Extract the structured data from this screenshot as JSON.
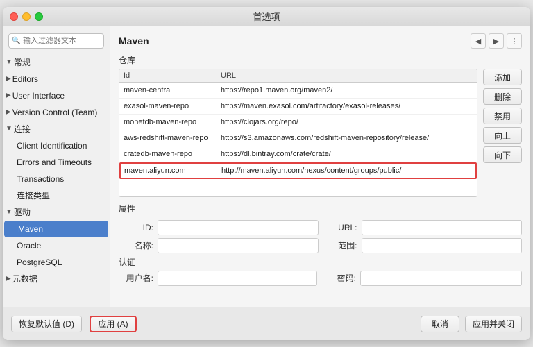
{
  "window": {
    "title": "首选项"
  },
  "search": {
    "placeholder": "输入过滤器文本"
  },
  "sidebar": {
    "items": [
      {
        "id": "general",
        "label": "常规",
        "level": "parent",
        "expanded": true
      },
      {
        "id": "editors",
        "label": "Editors",
        "level": "parent",
        "expanded": false
      },
      {
        "id": "user-interface",
        "label": "User Interface",
        "level": "parent",
        "expanded": false
      },
      {
        "id": "version-control",
        "label": "Version Control (Team)",
        "level": "parent",
        "expanded": false
      },
      {
        "id": "connections",
        "label": "连接",
        "level": "parent",
        "expanded": true
      },
      {
        "id": "client-id",
        "label": "Client Identification",
        "level": "child"
      },
      {
        "id": "errors",
        "label": "Errors and Timeouts",
        "level": "child"
      },
      {
        "id": "transactions",
        "label": "Transactions",
        "level": "child"
      },
      {
        "id": "conn-type",
        "label": "连接类型",
        "level": "child"
      },
      {
        "id": "driver",
        "label": "驱动",
        "level": "parent",
        "expanded": true
      },
      {
        "id": "maven",
        "label": "Maven",
        "level": "child",
        "selected": true
      },
      {
        "id": "oracle",
        "label": "Oracle",
        "level": "child"
      },
      {
        "id": "postgresql",
        "label": "PostgreSQL",
        "level": "child"
      },
      {
        "id": "metadata",
        "label": "元数据",
        "level": "parent",
        "expanded": false
      }
    ]
  },
  "main": {
    "title": "Maven",
    "repo_section_label": "仓库",
    "table": {
      "headers": [
        "Id",
        "URL"
      ],
      "rows": [
        {
          "id": "maven-central",
          "url": "https://repo1.maven.org/maven2/"
        },
        {
          "id": "exasol-maven-repo",
          "url": "https://maven.exasol.com/artifactory/exasol-releases/"
        },
        {
          "id": "monetdb-maven-repo",
          "url": "https://clojars.org/repo/"
        },
        {
          "id": "aws-redshift-maven-repo",
          "url": "https://s3.amazonaws.com/redshift-maven-repository/release/"
        },
        {
          "id": "cratedb-maven-repo",
          "url": "https://dl.bintray.com/crate/crate/"
        },
        {
          "id": "maven.aliyun.com",
          "url": "http://maven.aliyun.com/nexus/content/groups/public/",
          "selected": true
        }
      ]
    },
    "side_buttons": [
      "添加",
      "删除",
      "禁用",
      "向上",
      "向下"
    ],
    "properties_section_label": "属性",
    "properties": [
      {
        "label": "ID:",
        "key": "id"
      },
      {
        "label": "名称:",
        "key": "name"
      },
      {
        "label": "URL:",
        "key": "url"
      },
      {
        "label": "范围:",
        "key": "scope"
      }
    ],
    "auth_section_label": "认证",
    "auth": {
      "username_label": "用户名:",
      "password_label": "密码:"
    }
  },
  "footer": {
    "restore_defaults": "恢复默认值 (D)",
    "apply": "应用 (A)",
    "cancel": "取消",
    "apply_close": "应用并关闭"
  }
}
